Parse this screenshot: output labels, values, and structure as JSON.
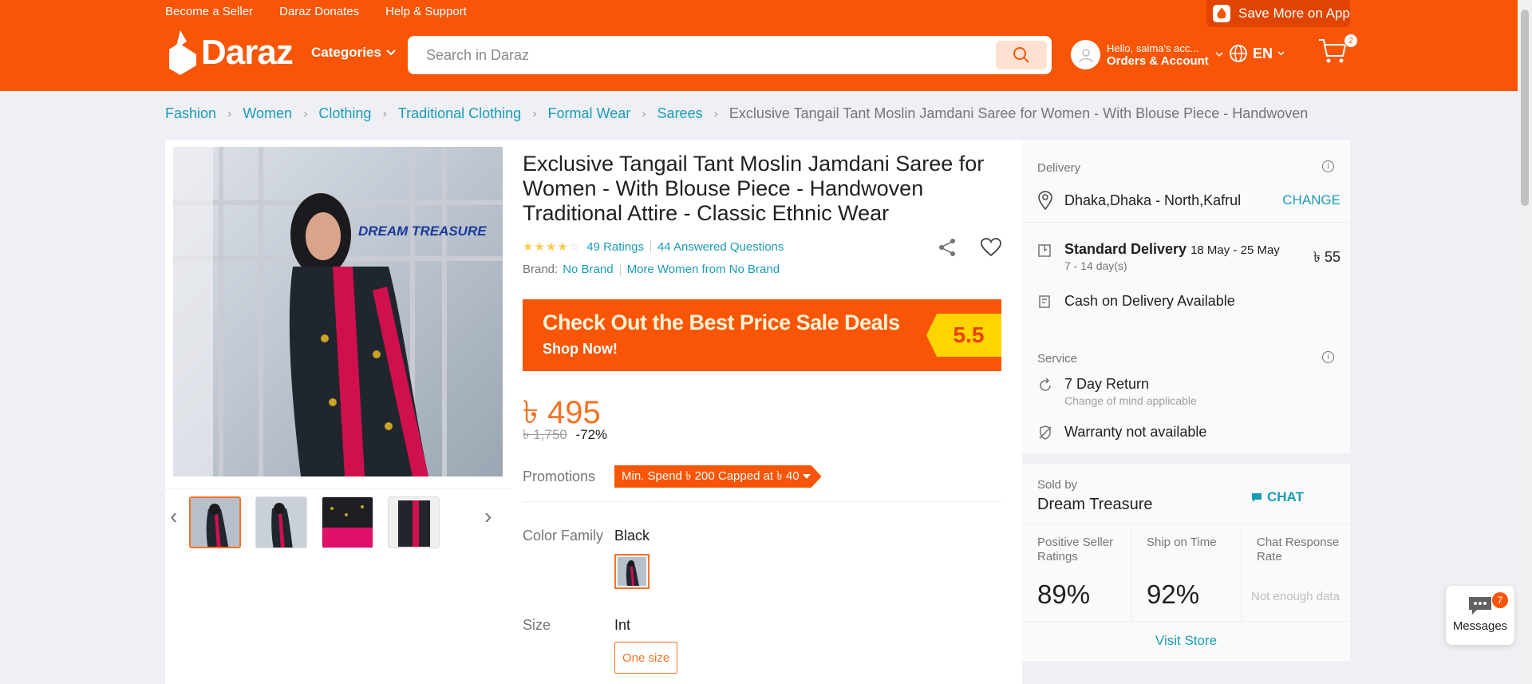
{
  "header": {
    "top_links": [
      "Become a Seller",
      "Daraz Donates",
      "Help & Support"
    ],
    "app_promo": "Save More on App",
    "logo_text": "Daraz",
    "categories_label": "Categories",
    "search_placeholder": "Search in Daraz",
    "account_hello": "Hello, saima's acc...",
    "account_orders": "Orders & Account",
    "language": "EN",
    "cart_count": "2",
    "brand_color": "#f85606"
  },
  "breadcrumb": {
    "items": [
      "Fashion",
      "Women",
      "Clothing",
      "Traditional Clothing",
      "Formal Wear",
      "Sarees"
    ],
    "current": "Exclusive Tangail Tant Moslin Jamdani Saree for Women - With Blouse Piece - Handwoven"
  },
  "product": {
    "title": "Exclusive Tangail Tant Moslin Jamdani Saree for Women - With Blouse Piece - Handwoven Traditional Attire - Classic Ethnic Wear",
    "image_watermark": "DREAM TREASURE",
    "rating_stars": 4,
    "ratings_link": "49 Ratings",
    "questions_link": "44 Answered Questions",
    "brand_label": "Brand:",
    "brand_value": "No Brand",
    "brand_more": "More Women from No Brand",
    "banner_line1": "Check Out the Best Price Sale Deals",
    "banner_line2": "Shop Now!",
    "banner_tag": "5.5",
    "price": "৳ 495",
    "original_price": "৳ 1,750",
    "discount": "-72%",
    "promotions_label": "Promotions",
    "promotion_chip": "Min. Spend ৳ 200 Capped at ৳ 40",
    "color_label": "Color Family",
    "color_value": "Black",
    "size_label": "Size",
    "size_value": "Int",
    "size_option": "One size"
  },
  "delivery": {
    "header": "Delivery",
    "location": "Dhaka,Dhaka - North,Kafrul",
    "change": "CHANGE",
    "standard": "Standard Delivery",
    "standard_dates": "18 May - 25 May",
    "standard_days": "7 - 14 day(s)",
    "standard_fee": "৳ 55",
    "cod": "Cash on Delivery Available"
  },
  "service": {
    "header": "Service",
    "return_title": "7 Day Return",
    "return_sub": "Change of mind applicable",
    "warranty": "Warranty not available"
  },
  "seller": {
    "sold_by_label": "Sold by",
    "name": "Dream Treasure",
    "chat": "CHAT",
    "metrics": [
      {
        "label": "Positive Seller Ratings",
        "value": "89%"
      },
      {
        "label": "Ship on Time",
        "value": "92%"
      },
      {
        "label": "Chat Response Rate",
        "value": "Not enough data"
      }
    ],
    "visit_store": "Visit Store"
  },
  "messages": {
    "label": "Messages",
    "count": "7"
  }
}
